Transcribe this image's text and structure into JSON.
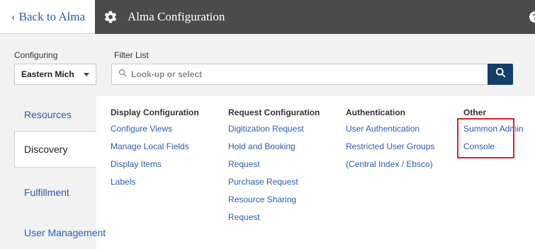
{
  "header": {
    "back_label": "Back to Alma",
    "title": "Alma Configuration",
    "help_glyph": "?"
  },
  "filter": {
    "configuring_label": "Configuring",
    "configuring_value": "Eastern Mich",
    "filter_label": "Filter List",
    "search_placeholder": "Look-up or select"
  },
  "sidebar": {
    "items": [
      {
        "label": "Resources"
      },
      {
        "label": "Discovery",
        "selected": true
      },
      {
        "label": "Fulfillment"
      },
      {
        "label": "User Management"
      }
    ]
  },
  "sections": [
    {
      "header": "Display Configuration",
      "links": [
        "Configure Views",
        "Manage Local Fields",
        "Display Items",
        "Labels"
      ]
    },
    {
      "header": "Request Configuration",
      "links": [
        "Digitization Request",
        "Hold and Booking",
        "Request",
        "Purchase Request",
        "Resource Sharing",
        "Request"
      ]
    },
    {
      "header": "Authentication",
      "links": [
        "User Authentication",
        "Restricted User Groups",
        "(Central Index / Ebsco)"
      ]
    },
    {
      "header": "Other",
      "links": [
        "Summon Admin",
        "Console"
      ]
    }
  ],
  "icons": {
    "back": "chevron-left-icon",
    "settings": "gear-icon",
    "help": "help-icon",
    "search": "search-icon",
    "dropdown": "caret-down-icon"
  },
  "colors": {
    "titlebar": "#4b4b4b",
    "link": "#2a5dad",
    "search_button": "#163e6b",
    "highlight": "#e0202a",
    "panel": "#f2f2f2"
  }
}
